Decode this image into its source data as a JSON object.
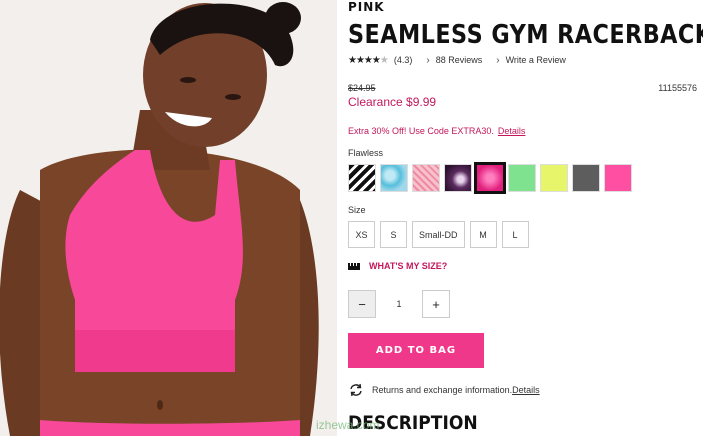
{
  "product": {
    "brand": "PINK",
    "title": "SEAMLESS GYM RACERBACK",
    "rating_stars": "★★★★",
    "rating_empty_star": "★",
    "rating_value": "(4.3)",
    "reviews_link": "88 Reviews",
    "write_review_link": "Write a Review",
    "original_price": "$24.95",
    "sale_price": "Clearance $9.99",
    "sku": "11155576"
  },
  "promo": {
    "text": "Extra 30% Off! Use Code EXTRA30.",
    "link": "Details"
  },
  "color": {
    "selected_name": "Flawless",
    "swatches": [
      {
        "name": "black-white-stripe",
        "color": "#222222"
      },
      {
        "name": "blue-tie-dye",
        "color": "#7fd0e6"
      },
      {
        "name": "pink-print",
        "color": "#f4a6b6"
      },
      {
        "name": "purple-tie-dye",
        "color": "#5b2a5e"
      },
      {
        "name": "hot-pink",
        "color": "#f0388a"
      },
      {
        "name": "mint-green",
        "color": "#7ee28f"
      },
      {
        "name": "neon-yellow",
        "color": "#e7f56a"
      },
      {
        "name": "charcoal",
        "color": "#5d5d5d"
      },
      {
        "name": "bright-pink",
        "color": "#ff4fa3"
      }
    ]
  },
  "size": {
    "label": "Size",
    "options": [
      "XS",
      "S",
      "Small-DD",
      "M",
      "L"
    ],
    "guide_link": "WHAT'S MY SIZE?"
  },
  "quantity": {
    "minus": "−",
    "value": "1",
    "plus": "+"
  },
  "actions": {
    "add_to_bag": "ADD TO BAG"
  },
  "returns": {
    "text": "Returns and exchange information.",
    "link": "Details"
  },
  "description_heading": "DESCRIPTION",
  "watermark": "izhewa.com",
  "colors": {
    "accent": "#c2185b",
    "button": "#f0388a"
  }
}
